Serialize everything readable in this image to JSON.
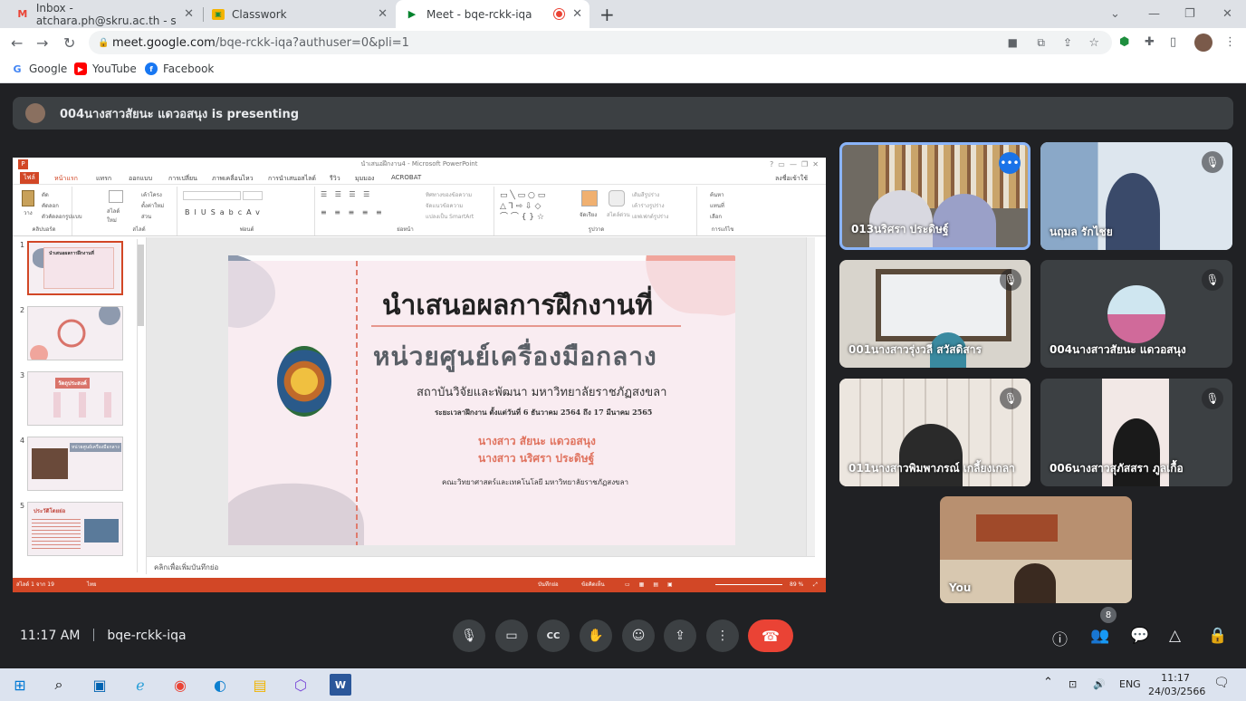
{
  "browser": {
    "tabs": [
      {
        "title": "Inbox - atchara.ph@skru.ac.th - s",
        "icon": "gmail-icon"
      },
      {
        "title": "Classwork",
        "icon": "classroom-icon"
      },
      {
        "title": "Meet - bqe-rckk-iqa",
        "icon": "meet-icon"
      }
    ],
    "url_host": "meet.google.com",
    "url_path": "/bqe-rckk-iqa?authuser=0&pli=1",
    "bookmarks": [
      "Google",
      "YouTube",
      "Facebook"
    ]
  },
  "meet": {
    "presenting": "004นางสาวสัยนะ แดวอสนุง is presenting",
    "time": "11:17 AM",
    "code": "bqe-rckk-iqa",
    "participant_count": "8",
    "participants": [
      {
        "name": "013นริศรา ประดิษฐ์"
      },
      {
        "name": "นฤมล รักไชย"
      },
      {
        "name": "001นางสาวรุ่งวลี สวัสดิสาร"
      },
      {
        "name": "004นางสาวสัยนะ แดวอสนุง"
      },
      {
        "name": "011นางสาวพิมพาภรณ์ เกลี้ยงเกลา"
      },
      {
        "name": "006นางสาวสุภัสสรา ภูลเกื้อ"
      },
      {
        "name": "You"
      }
    ]
  },
  "ppt": {
    "window_title": "นำเสนอฝึกงาน4 - Microsoft PowerPoint",
    "tabs": [
      "ไฟล์",
      "หน้าแรก",
      "แทรก",
      "ออกแบบ",
      "การเปลี่ยน",
      "ภาพเคลื่อนไหว",
      "การนำเสนอสไลด์",
      "รีวิว",
      "มุมมอง",
      "ACROBAT"
    ],
    "login": "ลงชื่อเข้าใช้",
    "groups": [
      "คลิปบอร์ด",
      "สไลด์",
      "ฟอนต์",
      "ย่อหน้า",
      "รูปวาด",
      "การแก้ไข"
    ],
    "ribbon_items": {
      "paste": "วาง",
      "cut": "ตัด",
      "copy": "คัดลอก",
      "format": "ตัวคัดลอกรูปแบบ",
      "new_slide": "สไลด์ใหม่",
      "layout": "เค้าโครง",
      "reset": "ตั้งค่าใหม่",
      "section": "ส่วน",
      "text_dir": "ทิศทางของข้อความ",
      "align_text": "จัดแนวข้อความ",
      "smartart": "แปลงเป็น SmartArt",
      "arrange": "จัดเรียง",
      "quick_styles": "สไตล์ด่วน",
      "fill": "เติมสีรูปร่าง",
      "outline": "เค้าร่างรูปร่าง",
      "effects": "เอฟเฟกต์รูปร่าง",
      "find": "ค้นหา",
      "replace": "แทนที่",
      "select": "เลือก"
    },
    "thumb_numbers": [
      "1",
      "2",
      "3",
      "4",
      "5"
    ],
    "thumb_titles": [
      "นำเสนอผลการฝึกงานที่",
      "",
      "วัตถุประสงค์",
      "หน่วยศูนย์เครื่องมือกลาง",
      "ประวัติโดยย่อ"
    ],
    "slide": {
      "title": "นำเสนอผลการฝึกงานที่",
      "subtitle": "หน่วยศูนย์เครื่องมือกลาง",
      "institute": "สถาบันวิจัยและพัฒนา มหาวิทยาลัยราชภัฏสงขลา",
      "period": "ระยะเวลาฝึกงาน ตั้งแต่วันที่ 6 ธันวาคม 2564 ถึง 17 มีนาคม 2565",
      "name1": "นางสาว สัยนะ แดวอสนุง",
      "name2": "นางสาว นริศรา ประดิษฐ์",
      "faculty": "คณะวิทยาศาสตร์และเทคโนโลยี มหาวิทยาลัยราชภัฏสงขลา"
    },
    "notes_placeholder": "คลิกเพื่อเพิ่มบันทึกย่อ",
    "status_slide": "สไลด์ 1 จาก 19",
    "status_lang": "ไทย",
    "status_notes": "บันทึกย่อ",
    "status_comments": "ข้อคิดเห็น",
    "zoom": "89 %"
  },
  "taskbar": {
    "lang": "ENG",
    "time": "11:17",
    "date": "24/03/2566"
  },
  "colors": {
    "accent": "#d24726",
    "meet_bg": "#202124",
    "end": "#ea4335",
    "salmon": "#f0a59c",
    "slate": "#8e9aae"
  }
}
